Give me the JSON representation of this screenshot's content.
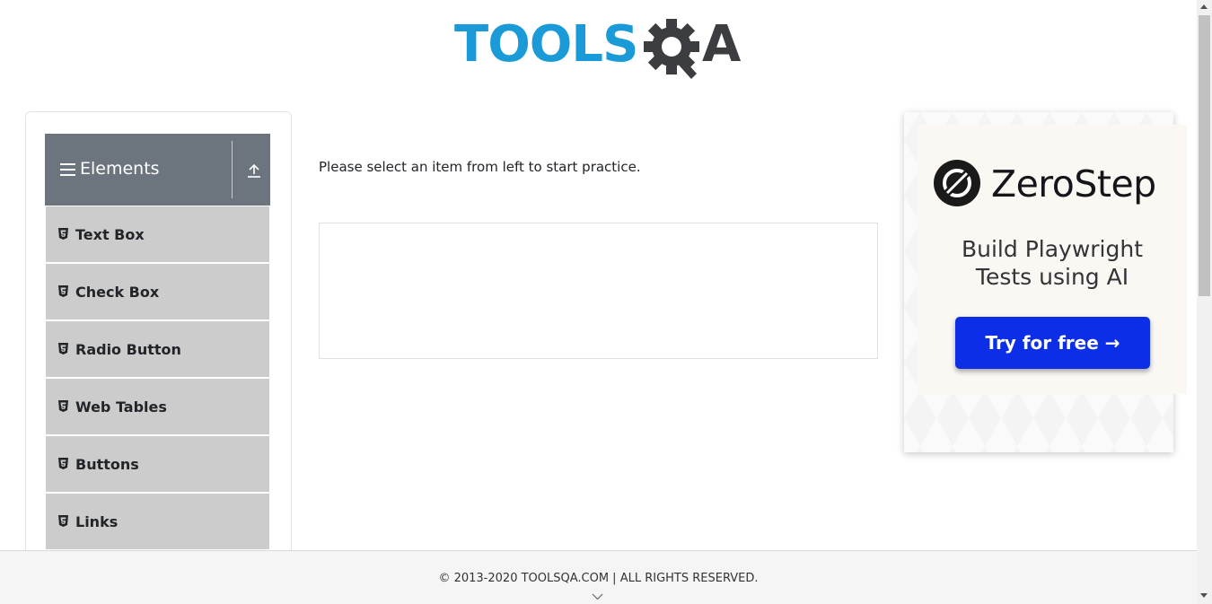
{
  "header": {
    "logo_text_left": "TOOLS",
    "logo_text_right": "A",
    "brand_color_blue": "#1a9ad6",
    "brand_color_dark": "#3b3d40"
  },
  "sidebar": {
    "group_title": "Elements",
    "group_icon": "hamburger-icon",
    "collapse_icon": "upload-arrow-icon",
    "items": [
      {
        "label": "Text Box",
        "icon": "html5-icon"
      },
      {
        "label": "Check Box",
        "icon": "html5-icon"
      },
      {
        "label": "Radio Button",
        "icon": "html5-icon"
      },
      {
        "label": "Web Tables",
        "icon": "html5-icon"
      },
      {
        "label": "Buttons",
        "icon": "html5-icon"
      },
      {
        "label": "Links",
        "icon": "html5-icon"
      }
    ]
  },
  "main": {
    "intro_text": "Please select an item from left to start practice."
  },
  "ad": {
    "brand": "ZeroStep",
    "tagline_line1": "Build Playwright",
    "tagline_line2": "Tests using AI",
    "cta_label": "Try for free →",
    "cta_color": "#0b2ee6"
  },
  "footer": {
    "copyright": "© 2013-2020 TOOLSQA.COM | ALL RIGHTS RESERVED."
  }
}
